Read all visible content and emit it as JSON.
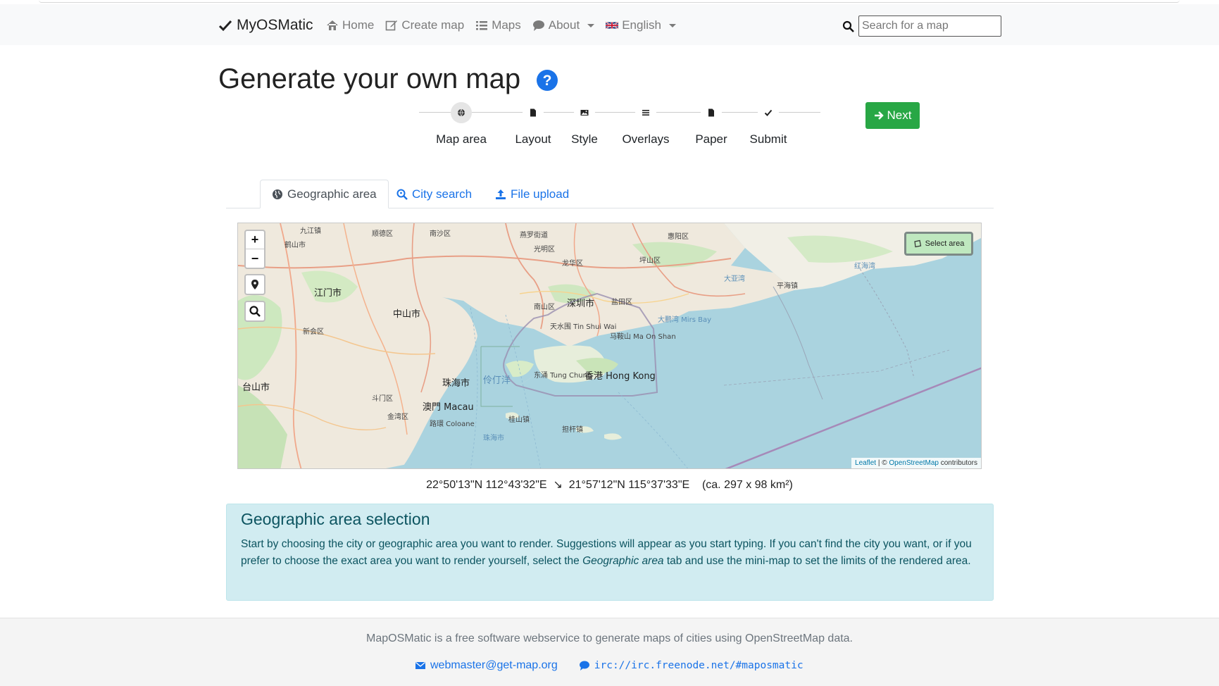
{
  "navbar": {
    "brand": "MyOSMatic",
    "items": [
      {
        "label": "Home",
        "icon": "home-icon"
      },
      {
        "label": "Create map",
        "icon": "edit-icon"
      },
      {
        "label": "Maps",
        "icon": "list-icon"
      },
      {
        "label": "About",
        "icon": "comment-icon"
      },
      {
        "label": "English",
        "icon": "uk-flag-icon"
      }
    ],
    "search_placeholder": "Search for a map"
  },
  "page": {
    "title": "Generate your own map"
  },
  "stepper": {
    "steps": [
      {
        "label": "Map area",
        "icon": "globe-icon",
        "active": true
      },
      {
        "label": "Layout",
        "icon": "file-icon"
      },
      {
        "label": "Style",
        "icon": "image-icon"
      },
      {
        "label": "Overlays",
        "icon": "bars-icon"
      },
      {
        "label": "Paper",
        "icon": "file-icon"
      },
      {
        "label": "Submit",
        "icon": "check-icon"
      }
    ],
    "next_label": "Next"
  },
  "tabs": [
    {
      "label": "Geographic area",
      "icon": "globe-icon",
      "active": true
    },
    {
      "label": "City search",
      "icon": "search-location-icon"
    },
    {
      "label": "File upload",
      "icon": "upload-icon"
    }
  ],
  "map": {
    "zoom_in": "+",
    "zoom_out": "−",
    "select_area": "Select area",
    "attribution_leaflet": "Leaflet",
    "attribution_sep": " | © ",
    "attribution_osm": "OpenStreetMap",
    "attribution_tail": " contributors",
    "labels": {
      "l1": "九江镇",
      "l2": "顺德区",
      "l3": "南沙区",
      "l4": "燕罗街道",
      "l5": "惠阳区",
      "l6": "鹤山市",
      "l7": "光明区",
      "l8": "龙华区",
      "l9": "坪山区",
      "l10": "江门市",
      "l11": "中山市",
      "l12": "南山区",
      "l13": "深圳市",
      "l14": "盐田区",
      "l15": "新会区",
      "l16": "大亚湾",
      "l17": "红海湾",
      "l18": "平海镇",
      "l19": "台山市",
      "l20": "珠海市",
      "l21": "伶仃洋",
      "l22": "东涌 Tung Chung",
      "l23": "香港 Hong Kong",
      "l24": "澳門 Macau",
      "l25": "斗门区",
      "l26": "金湾区",
      "l27": "大鹏湾 Mirs Bay",
      "l28": "天水围 Tin Shui Wai",
      "l29": "马鞍山 Ma On Shan",
      "l30": "路環 Coloane",
      "l31": "桂山镇",
      "l32": "担杆镇",
      "l33": "珠海市"
    }
  },
  "coords": {
    "nw": "22°50'13\"N 112°43'32\"E",
    "arrow": "↘",
    "se": "21°57'12\"N 115°37'33\"E",
    "area": "(ca. 297 x 98 km²)"
  },
  "info": {
    "title": "Geographic area selection",
    "text_1": "Start by choosing the city or geographic area you want to render. Suggestions will appear as you start typing. If you can't find the city you want, or if you prefer to choose the exact area you want to render yourself, select the ",
    "text_em": "Geographic area",
    "text_2": " tab and use the mini-map to set the limits of the rendered area."
  },
  "footer": {
    "text": "MapOSMatic is a free software webservice to generate maps of cities using OpenStreetMap data.",
    "email": "webmaster@get-map.org",
    "irc": "irc://irc.freenode.net/#maposmatic"
  },
  "colors": {
    "primary": "#1a73e8",
    "success": "#28a745",
    "info_bg": "#d1ecf1",
    "info_text": "#0c5460",
    "water": "#aad3df"
  }
}
